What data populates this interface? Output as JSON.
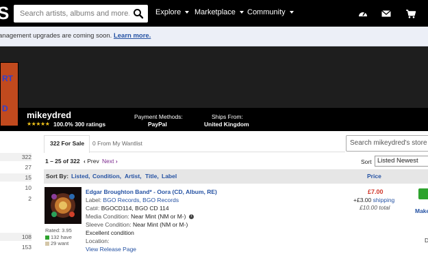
{
  "colors": {
    "link": "#2552a3",
    "price": "#d0362a",
    "cart": "#2ea32e",
    "star": "#f0c21b",
    "purple": "#7d2b8f"
  },
  "logo_fragment": "S",
  "header": {
    "search_placeholder": "Search artists, albums and more...",
    "nav": [
      "Explore",
      "Marketplace",
      "Community"
    ],
    "icons": [
      "search-icon",
      "dashboard-icon",
      "envelope-icon",
      "cart-icon"
    ]
  },
  "banner": {
    "text": "anagement upgrades are coming soon.",
    "link": "Learn more."
  },
  "avatar_text": [
    "RT",
    "D"
  ],
  "seller": {
    "name": "mikeydred",
    "stars": "★★★★★",
    "rating": "100.0% 300 ratings",
    "payment_label": "Payment Methods:",
    "payment_value": "PayPal",
    "ships_label": "Ships From:",
    "ships_value": "United Kingdom"
  },
  "sidebar_counts": [
    "322",
    "27",
    "15",
    "10",
    "2",
    "108",
    "153"
  ],
  "tabs": {
    "for_sale": "322 For Sale",
    "wantlist": "0 From My Wantlist"
  },
  "store_search_placeholder": "Search mikeydred's store",
  "pagination": {
    "range": "1 – 25 of 322",
    "prev": "Prev",
    "next": "Next"
  },
  "sort": {
    "label": "Sort",
    "value": "Listed Newest"
  },
  "sort_by": {
    "label": "Sort By:",
    "options": [
      "Listed,",
      "Condition,",
      "Artist,",
      "Title,",
      "Label"
    ],
    "price": "Price"
  },
  "item": {
    "title": "Edgar Broughton Band* - Oora (CD, Album, RE)",
    "label_key": "Label:",
    "label_value": "BGO Records, BGO Records",
    "cat_key": "Cat#:",
    "cat_value": "BGOCD114, BGO CD 114",
    "media_key": "Media Condition:",
    "media_value": "Near Mint (NM or M-)",
    "sleeve_key": "Sleeve Condition:",
    "sleeve_value": "Near Mint (NM or M-)",
    "comment": "Excellent condition",
    "location_key": "Location:",
    "view_link": "View Release Page",
    "rated": "Rated: 3.95",
    "have": "132 have",
    "want": "29 want",
    "price": "£7.00",
    "shipping_amount": "+£3.00",
    "shipping_link": "shipping",
    "total": "£10.00 total",
    "make_offer": "Make",
    "status_fragment": "D"
  }
}
